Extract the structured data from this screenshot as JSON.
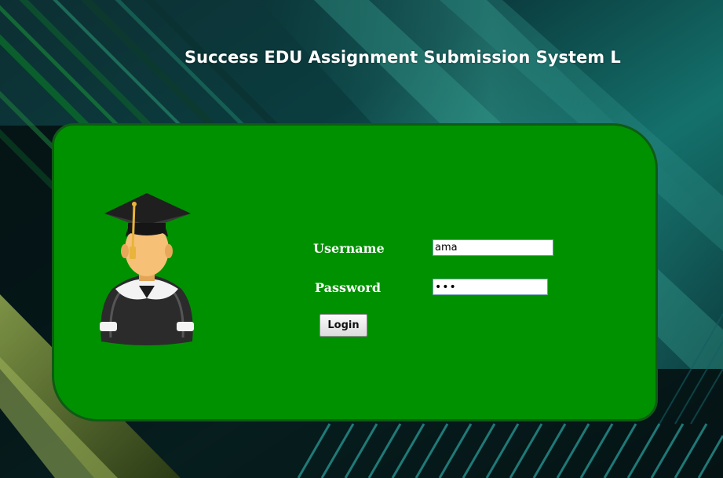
{
  "header": {
    "title": "Success EDU Assignment Submission System L"
  },
  "login_form": {
    "username_label": "Username",
    "username_value": "ama",
    "password_label": "Password",
    "password_value": "•••",
    "login_button_label": "Login"
  },
  "icons": {
    "avatar": "graduate-avatar-icon"
  },
  "colors": {
    "panel_background": "#009100",
    "panel_border": "#0f5b14",
    "title_text": "#ffffff",
    "label_text": "#ffffff"
  }
}
